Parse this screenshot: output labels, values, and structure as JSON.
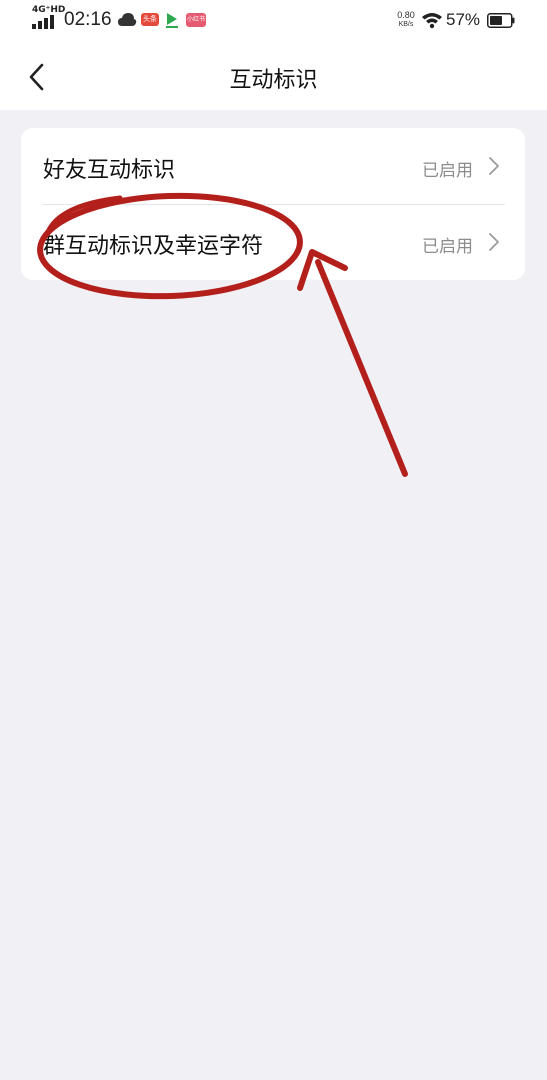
{
  "status_bar": {
    "network": "4G⁺HD",
    "time": "02:16",
    "app_badge_1": "头条",
    "app_badge_3": "小红书",
    "net_speed_value": "0.80",
    "net_speed_unit": "KB/s",
    "battery_percent": "57%",
    "icons": [
      "signal-icon",
      "cloud-icon",
      "app-notification-icon",
      "wifi-icon",
      "battery-icon"
    ]
  },
  "header": {
    "title": "互动标识",
    "back_icon": "chevron-left-icon"
  },
  "settings": {
    "items": [
      {
        "label": "好友互动标识",
        "status": "已启用",
        "icon": "chevron-right-icon"
      },
      {
        "label": "群互动标识及幸运字符",
        "status": "已启用",
        "icon": "chevron-right-icon"
      }
    ]
  },
  "colors": {
    "background": "#f1f0f5",
    "card": "#ffffff",
    "status_text": "#8c8c8c",
    "annotation": "#b3201c"
  }
}
